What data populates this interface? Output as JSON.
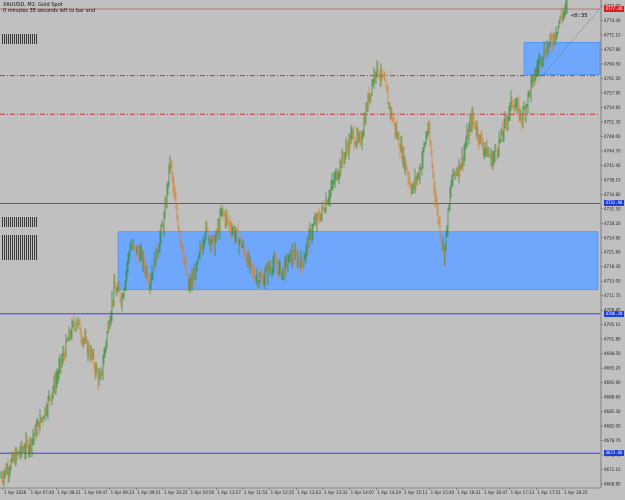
{
  "header": {
    "symbol_line": "XAUUSD, M1: Gold Spot",
    "countdown_line": "0 minutes 35 seconds left to bar end"
  },
  "countdown_value": "<0:35",
  "colors": {
    "background": "#c0c0c0",
    "up_candle": "#2e8b2e",
    "down_candle": "#d9822b",
    "zone_fill": "#6aa6ff",
    "zone_edge": "#3b82f6",
    "blue_level": "#1d2ff5",
    "red_dashdot": "#d11a1a",
    "bid_line": "#c62020",
    "tag_blue": "#1f3fd8",
    "tag_red": "#d42020"
  },
  "price_tags": [
    {
      "name": "price-tag-current",
      "value": "4777.36",
      "color": "#d42020"
    },
    {
      "name": "price-tag-level-1",
      "value": "4731.96",
      "color": "#1f3fd8"
    },
    {
      "name": "price-tag-level-2",
      "value": "4706.20",
      "color": "#1f3fd8"
    },
    {
      "name": "price-tag-level-3",
      "value": "4673.66",
      "color": "#1f3fd8"
    }
  ],
  "chart_data": {
    "type": "candlestick",
    "title": "",
    "y_ticks": [
      "4777.70",
      "4774.40",
      "4771.10",
      "4767.80",
      "4764.50",
      "4761.20",
      "4757.90",
      "4754.60",
      "4751.30",
      "4748.00",
      "4744.70",
      "4741.40",
      "4738.10",
      "4734.80",
      "4731.50",
      "4728.20",
      "4724.90",
      "4721.60",
      "4718.30",
      "4715.00",
      "4711.70",
      "4708.40",
      "4705.10",
      "4701.80",
      "4698.50",
      "4695.20",
      "4691.90",
      "4688.60",
      "4685.30",
      "4682.00",
      "4678.70",
      "4675.40",
      "4672.10",
      "4668.80"
    ],
    "x_ticks": [
      "1 Apr 2026",
      "1 Apr 07:40",
      "1 Apr 08:21",
      "1 Apr 09:47",
      "1 Apr 09:23",
      "1 Apr 09:51",
      "1 Apr 10:22",
      "1 Apr 10:50",
      "1 Apr 11:27",
      "1 Apr 11:53",
      "1 Apr 12:25",
      "1 Apr 13:03",
      "1 Apr 13:33",
      "1 Apr 14:07",
      "1 Apr 14:29",
      "1 Apr 15:11",
      "1 Apr 15:40",
      "1 Apr 16:31",
      "1 Apr 16:47",
      "1 Apr 17:13",
      "1 Apr 17:51",
      "1 Apr 18:22"
    ],
    "y_range": [
      4666.0,
      4779.0
    ],
    "zones": [
      {
        "name": "demand-zone-large",
        "top": 4725.4,
        "bottom": 4711.8
      },
      {
        "name": "supply-zone-upper",
        "top": 4769.6,
        "bottom": 4762.0
      }
    ],
    "levels": [
      {
        "name": "blue-level-1",
        "price": 4731.96,
        "style": "solid",
        "color": "#1d2ff5"
      },
      {
        "name": "blue-level-2",
        "price": 4706.2,
        "style": "solid",
        "color": "#1d2ff5"
      },
      {
        "name": "blue-level-3",
        "price": 4673.66,
        "style": "solid",
        "color": "#1d2ff5"
      },
      {
        "name": "red-level-1",
        "price": 4761.8,
        "style": "dashdot",
        "color": "#d11a1a"
      },
      {
        "name": "red-level-2",
        "price": 4752.8,
        "style": "dashdot",
        "color": "#d11a1a"
      },
      {
        "name": "bid-line",
        "price": 4777.36,
        "style": "solid",
        "color": "#c62020"
      }
    ],
    "price_path": [
      [
        0,
        4668
      ],
      [
        10,
        4671
      ],
      [
        20,
        4674
      ],
      [
        30,
        4676
      ],
      [
        42,
        4682
      ],
      [
        55,
        4690
      ],
      [
        68,
        4700
      ],
      [
        76,
        4705
      ],
      [
        84,
        4700
      ],
      [
        92,
        4696
      ],
      [
        100,
        4690
      ],
      [
        106,
        4700
      ],
      [
        114,
        4712
      ],
      [
        122,
        4710
      ],
      [
        130,
        4722
      ],
      [
        140,
        4720
      ],
      [
        150,
        4714
      ],
      [
        158,
        4722
      ],
      [
        164,
        4728
      ],
      [
        170,
        4742
      ],
      [
        176,
        4730
      ],
      [
        182,
        4722
      ],
      [
        188,
        4712
      ],
      [
        196,
        4716
      ],
      [
        205,
        4726
      ],
      [
        214,
        4722
      ],
      [
        222,
        4730
      ],
      [
        232,
        4726
      ],
      [
        242,
        4722
      ],
      [
        252,
        4716
      ],
      [
        262,
        4714
      ],
      [
        272,
        4718
      ],
      [
        282,
        4716
      ],
      [
        292,
        4720
      ],
      [
        302,
        4718
      ],
      [
        312,
        4726
      ],
      [
        322,
        4730
      ],
      [
        332,
        4736
      ],
      [
        342,
        4742
      ],
      [
        352,
        4748
      ],
      [
        360,
        4746
      ],
      [
        368,
        4756
      ],
      [
        376,
        4764
      ],
      [
        384,
        4760
      ],
      [
        392,
        4752
      ],
      [
        402,
        4744
      ],
      [
        412,
        4735
      ],
      [
        420,
        4740
      ],
      [
        428,
        4750
      ],
      [
        436,
        4732
      ],
      [
        444,
        4720
      ],
      [
        452,
        4738
      ],
      [
        462,
        4742
      ],
      [
        472,
        4752
      ],
      [
        482,
        4746
      ],
      [
        492,
        4742
      ],
      [
        502,
        4748
      ],
      [
        512,
        4756
      ],
      [
        522,
        4752
      ],
      [
        532,
        4760
      ],
      [
        542,
        4767
      ],
      [
        552,
        4770
      ],
      [
        562,
        4776
      ],
      [
        567,
        4777.36
      ]
    ]
  }
}
